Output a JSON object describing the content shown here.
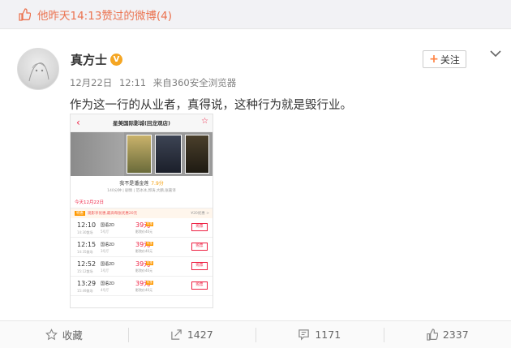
{
  "liked_bar": {
    "text": "他昨天14:13赞过的微博(4)"
  },
  "post": {
    "username": "真方士",
    "verified_badge": "V",
    "date": "12月22日",
    "time": "12:11",
    "source_prefix": "来自",
    "source": "360安全浏览器",
    "follow_plus": "+",
    "follow_label": "关注",
    "text": "作为这一行的从业者，真得说，这种行为就是毁行业。"
  },
  "embedded_screenshot": {
    "cinema_title": "星美国际影城(回龙观店)",
    "movie_name": "我不是潘金莲",
    "score": "7.9分",
    "movie_info": "140分钟 | 剧情 | 范冰冰,郭涛,大鹏,张嘉译",
    "date_tab": "今天12月22日",
    "promo_tag": "特惠",
    "promo_text": "观影享优惠,最高每张优惠20元",
    "promo_right": "¥20优惠 >",
    "showtimes": [
      {
        "time": "12:10",
        "end": "14:30散场",
        "lang": "国语2D",
        "hall": "5号厅",
        "price": "39元",
        "badge": "特惠",
        "save": "影院价40元",
        "buy": "购票"
      },
      {
        "time": "12:15",
        "end": "14:35散场",
        "lang": "国语2D",
        "hall": "3号厅",
        "price": "39元",
        "badge": "特惠",
        "save": "影院价40元",
        "buy": "购票"
      },
      {
        "time": "12:52",
        "end": "15:12散场",
        "lang": "国语2D",
        "hall": "1号厅",
        "price": "39元",
        "badge": "特惠",
        "save": "影院价40元",
        "buy": "购票"
      },
      {
        "time": "13:29",
        "end": "15:49散场",
        "lang": "国语2D",
        "hall": "4号厅",
        "price": "39元",
        "badge": "特惠",
        "save": "影院价40元",
        "buy": "购票"
      }
    ]
  },
  "actions": {
    "favorite_label": "收藏",
    "repost_count": "1427",
    "comment_count": "1171",
    "like_count": "2337"
  },
  "colors": {
    "accent": "#eb7350",
    "follow_plus": "#ff8140",
    "badge": "#f5a623"
  },
  "icons": [
    "thumb-up-icon",
    "verified-icon",
    "chevron-down-icon",
    "star-icon",
    "repost-icon",
    "comment-icon",
    "like-icon"
  ]
}
